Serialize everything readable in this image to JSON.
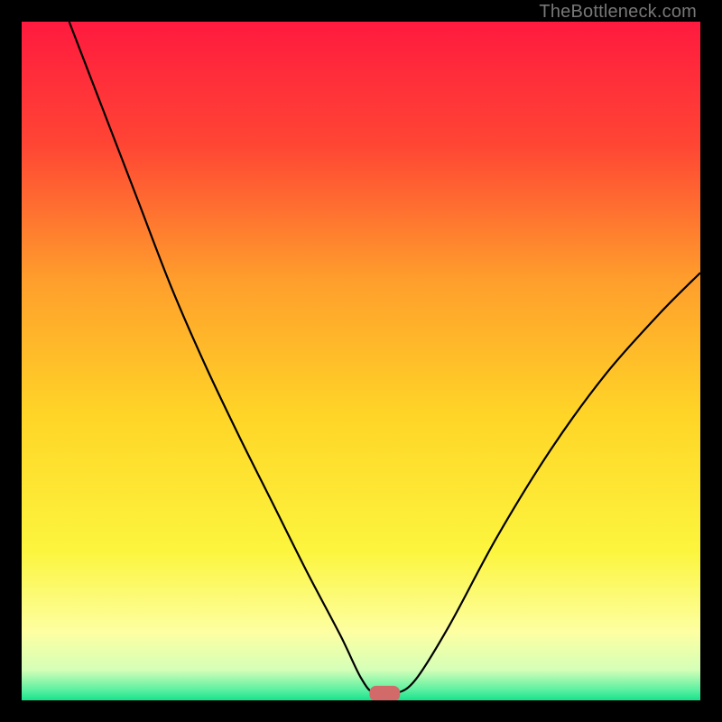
{
  "watermark": "TheBottleneck.com",
  "chart_data": {
    "type": "line",
    "title": "",
    "xlabel": "",
    "ylabel": "",
    "xlim": [
      0,
      100
    ],
    "ylim": [
      0,
      100
    ],
    "grid": false,
    "background": {
      "type": "vertical-gradient",
      "stops": [
        {
          "pos": 0.0,
          "color": "#ff1a3f"
        },
        {
          "pos": 0.18,
          "color": "#ff4534"
        },
        {
          "pos": 0.38,
          "color": "#ff9e2c"
        },
        {
          "pos": 0.58,
          "color": "#ffd527"
        },
        {
          "pos": 0.78,
          "color": "#fcf53e"
        },
        {
          "pos": 0.9,
          "color": "#fdffa2"
        },
        {
          "pos": 0.955,
          "color": "#d5ffb8"
        },
        {
          "pos": 0.985,
          "color": "#5af0a1"
        },
        {
          "pos": 1.0,
          "color": "#18e28b"
        }
      ]
    },
    "series": [
      {
        "name": "bottleneck-curve",
        "stroke": "#000000",
        "stroke_width": 2.2,
        "points": [
          {
            "x": 7.0,
            "y": 100.0
          },
          {
            "x": 12.0,
            "y": 87.0
          },
          {
            "x": 17.0,
            "y": 74.0
          },
          {
            "x": 22.0,
            "y": 61.0
          },
          {
            "x": 27.0,
            "y": 49.5
          },
          {
            "x": 32.0,
            "y": 39.0
          },
          {
            "x": 37.0,
            "y": 29.0
          },
          {
            "x": 42.0,
            "y": 19.0
          },
          {
            "x": 47.0,
            "y": 9.5
          },
          {
            "x": 50.0,
            "y": 3.3
          },
          {
            "x": 52.0,
            "y": 1.0
          },
          {
            "x": 55.0,
            "y": 1.0
          },
          {
            "x": 58.0,
            "y": 3.0
          },
          {
            "x": 63.0,
            "y": 11.0
          },
          {
            "x": 70.0,
            "y": 24.0
          },
          {
            "x": 78.0,
            "y": 37.0
          },
          {
            "x": 86.0,
            "y": 48.0
          },
          {
            "x": 94.0,
            "y": 57.0
          },
          {
            "x": 100.0,
            "y": 63.0
          }
        ]
      }
    ],
    "marker": {
      "shape": "rounded-rect",
      "x": 53.5,
      "y": 1.0,
      "width": 4.5,
      "height": 2.3,
      "fill": "#d36a6a"
    }
  }
}
